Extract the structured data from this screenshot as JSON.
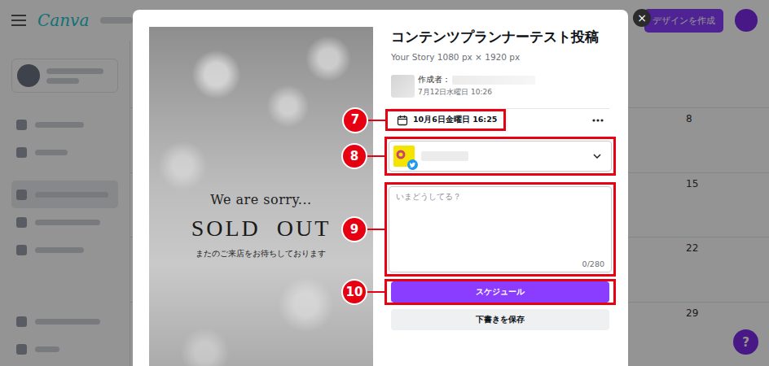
{
  "app": {
    "logo": "Canva",
    "create_button": "デザインを作成",
    "calendar_days": [
      "8",
      "15",
      "22",
      "29"
    ],
    "help_button": "?"
  },
  "modal": {
    "close_button": "×",
    "title": "コンテンツプランナーテスト投稿",
    "subtitle": "Your Story 1080 px × 1920 px",
    "author_label": "作成者：",
    "created": "7月12日水曜日 10:26",
    "scheduled_date": "10月6日金曜日 16:25",
    "message": {
      "placeholder": "いまどうしてる？",
      "counter": "0/280"
    },
    "schedule_button": "スケジュール",
    "draft_button": "下書きを保存"
  },
  "design": {
    "lines": [
      "We are sorry...",
      "SOLD  OUT",
      "またのご来店をお待ちしております"
    ]
  },
  "callouts": {
    "date": "7",
    "account": "8",
    "message": "9",
    "schedule": "10"
  }
}
